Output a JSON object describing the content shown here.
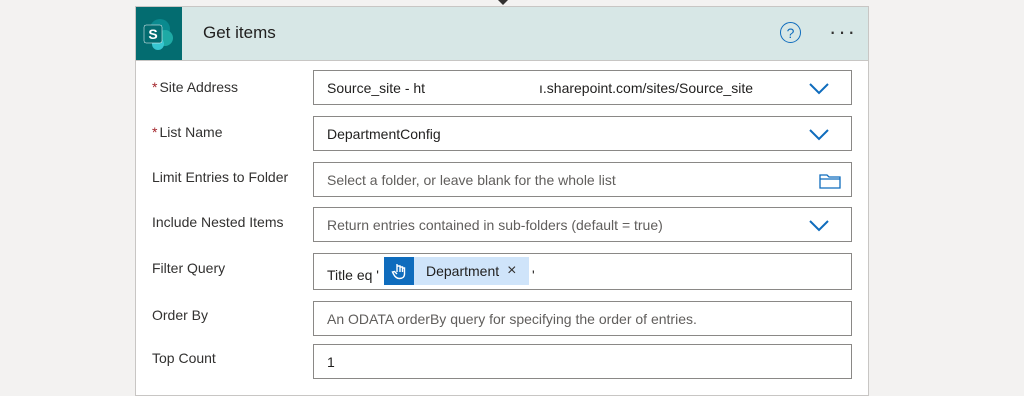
{
  "card": {
    "title": "Get items",
    "app_icon": "sharepoint-icon",
    "app_icon_letter": "S",
    "help_glyph": "?",
    "more_glyph": "···",
    "accent_color": "#0f6cbd",
    "header_color": "#d7e7e6"
  },
  "fields": {
    "site_address": {
      "label": "Site Address",
      "required_mark": "*",
      "value_start": "Source_site - ht",
      "value_end": "ı.sharepoint.com/sites/Source_site"
    },
    "list_name": {
      "label": "List Name",
      "required_mark": "*",
      "value": "DepartmentConfig"
    },
    "limit_folder": {
      "label": "Limit Entries to Folder",
      "placeholder": "Select a folder, or leave blank for the whole list"
    },
    "nested_items": {
      "label": "Include Nested Items",
      "placeholder": "Return entries contained in sub-folders (default = true)"
    },
    "filter_query": {
      "label": "Filter Query",
      "prefix": "Title eq '",
      "token_label": "Department",
      "token_close": "×",
      "suffix": "'"
    },
    "order_by": {
      "label": "Order By",
      "placeholder": "An ODATA orderBy query for specifying the order of entries."
    },
    "top_count": {
      "label": "Top Count",
      "value": "1"
    }
  }
}
